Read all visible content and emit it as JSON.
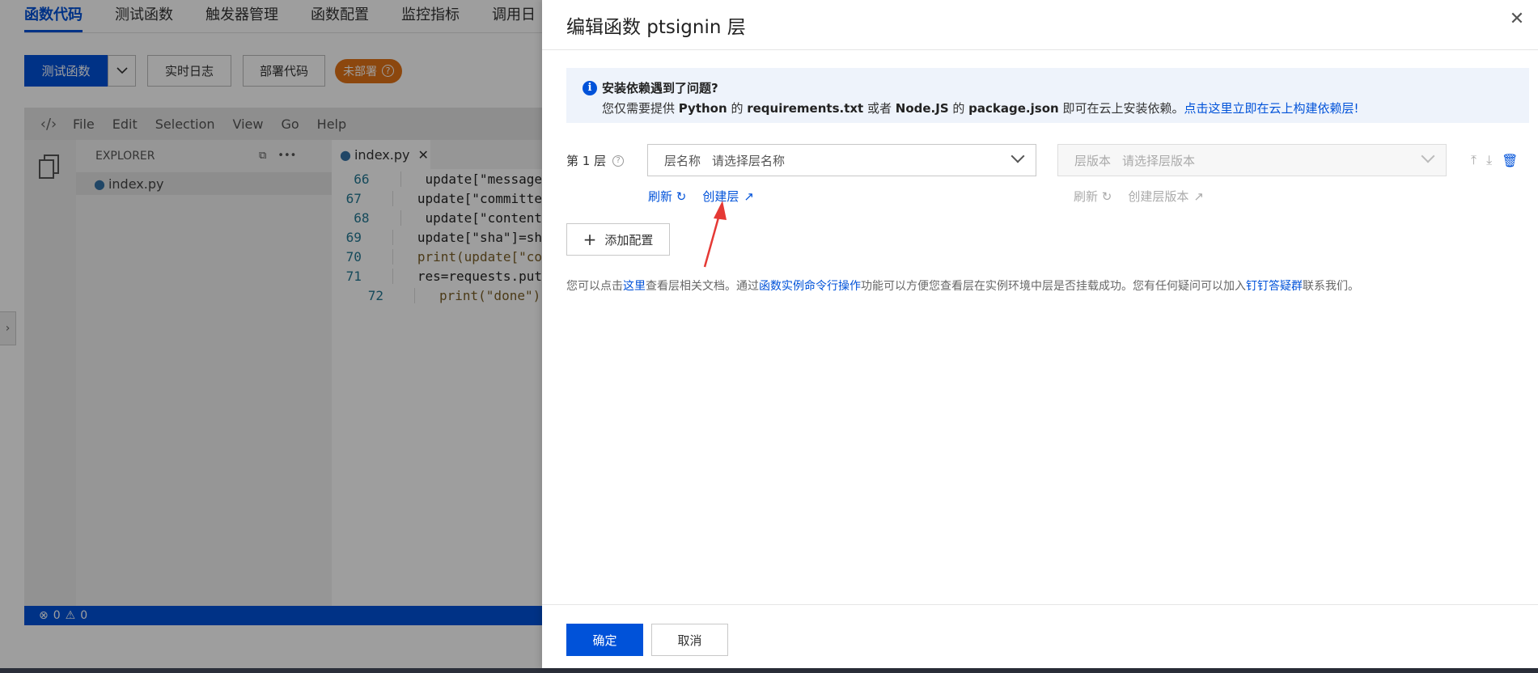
{
  "tabs": [
    "函数代码",
    "测试函数",
    "触发器管理",
    "函数配置",
    "监控指标",
    "调用日"
  ],
  "toolbar": {
    "test_button": "测试函数",
    "realtime_log": "实时日志",
    "deploy_code": "部署代码",
    "status_badge": "未部署"
  },
  "ide": {
    "menu": [
      "File",
      "Edit",
      "Selection",
      "View",
      "Go",
      "Help"
    ],
    "explorer_title": "EXPLORER",
    "file": "index.py",
    "editor_tab": "index.py",
    "code_lines": [
      {
        "num": "66",
        "text": "update[\"message"
      },
      {
        "num": "67",
        "text": "update[\"committe"
      },
      {
        "num": "68",
        "text": "update[\"content"
      },
      {
        "num": "69",
        "text": "update[\"sha\"]=sh"
      },
      {
        "num": "70",
        "text": "print(update[\"co"
      },
      {
        "num": "71",
        "text": "res=requests.put"
      },
      {
        "num": "72",
        "text": "print(\"done\")"
      }
    ],
    "status_errors": "0",
    "status_warnings": "0"
  },
  "drawer": {
    "title": "编辑函数 ptsignin 层",
    "info": {
      "title": "安装依赖遇到了问题?",
      "line_pre": "您仅需要提供 ",
      "python": "Python",
      "de1": " 的 ",
      "req": "requirements.txt",
      "or": " 或者 ",
      "node": "Node.JS",
      "de2": " 的 ",
      "pkg": "package.json",
      "line_mid": " 即可在云上安装依赖。",
      "link": "点击这里立即在云上构建依赖层!"
    },
    "layer_label": "第 1 层",
    "layer_name_label": "层名称",
    "layer_name_placeholder": "请选择层名称",
    "layer_version_label": "层版本",
    "layer_version_placeholder": "请选择层版本",
    "refresh": "刷新",
    "create_layer": "创建层",
    "refresh2": "刷新",
    "create_version": "创建层版本",
    "add_config": "添加配置",
    "note": {
      "p1": "您可以点击",
      "l1": "这里",
      "p2": "查看层相关文档。通过",
      "l2": "函数实例命令行操作",
      "p3": "功能可以方便您查看层在实例环境中层是否挂载成功。您有任何疑问可以加入",
      "l3": "钉钉答疑群",
      "p4": "联系我们。"
    },
    "ok": "确定",
    "cancel": "取消"
  },
  "colors": {
    "primary": "#0052d9",
    "badge": "#e37318",
    "annotation_arrow": "#e53935"
  }
}
